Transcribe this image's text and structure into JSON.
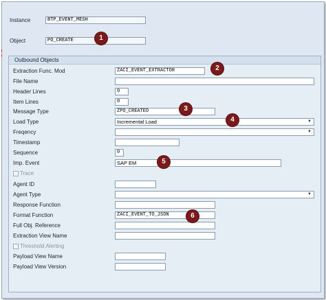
{
  "header": {
    "instance_label": "Instance",
    "instance_value": "BTP_EVENT_MESH",
    "object_label": "Object",
    "object_value": "PO_CREATE"
  },
  "group_title": "Outbound  Objects",
  "rows": {
    "extraction_func_mod": {
      "label": "Extraction Func. Mod",
      "value": "ZACI_EVENT_EXTRACTOR"
    },
    "file_name": {
      "label": "File Name",
      "value": ""
    },
    "header_lines": {
      "label": "Header Lines",
      "value": "0"
    },
    "item_lines": {
      "label": "Item Lines",
      "value": "0"
    },
    "message_type": {
      "label": "Message Type",
      "value": "ZPO_CREATED"
    },
    "load_type": {
      "label": "Load Type",
      "value": "Incremental Load"
    },
    "frequency": {
      "label": "Freqency",
      "value": ""
    },
    "timestamp": {
      "label": "Timestamp",
      "value": ""
    },
    "sequence": {
      "label": "Sequence",
      "value": "0"
    },
    "imp_event": {
      "label": "Imp. Event",
      "value": "SAP EM"
    },
    "trace": {
      "label": "Trace"
    },
    "agent_id": {
      "label": "Agent ID",
      "value": ""
    },
    "agent_type": {
      "label": "Agent Type",
      "value": ""
    },
    "response_function": {
      "label": "Response Function",
      "value": ""
    },
    "format_function": {
      "label": "Format Function",
      "value": "ZACI_EVENT_TO_JSON"
    },
    "full_obj_reference": {
      "label": "Full Obj. Reference",
      "value": ""
    },
    "extraction_view_name": {
      "label": "Extraction View Name",
      "value": ""
    },
    "threshold_alerting": {
      "label": "Threshold Alerting"
    },
    "payload_view_name": {
      "label": "Payload View Name",
      "value": ""
    },
    "payload_view_version": {
      "label": "Payload View Version",
      "value": ""
    }
  },
  "markers": [
    "1",
    "2",
    "3",
    "4",
    "5",
    "6"
  ],
  "icons": {
    "dropdown": "chevron-down-icon",
    "checkbox": "checkbox-icon"
  },
  "colors": {
    "marker": "#7a1a1a",
    "group_header": "#d3e0ee",
    "background": "#dfe8f2"
  }
}
